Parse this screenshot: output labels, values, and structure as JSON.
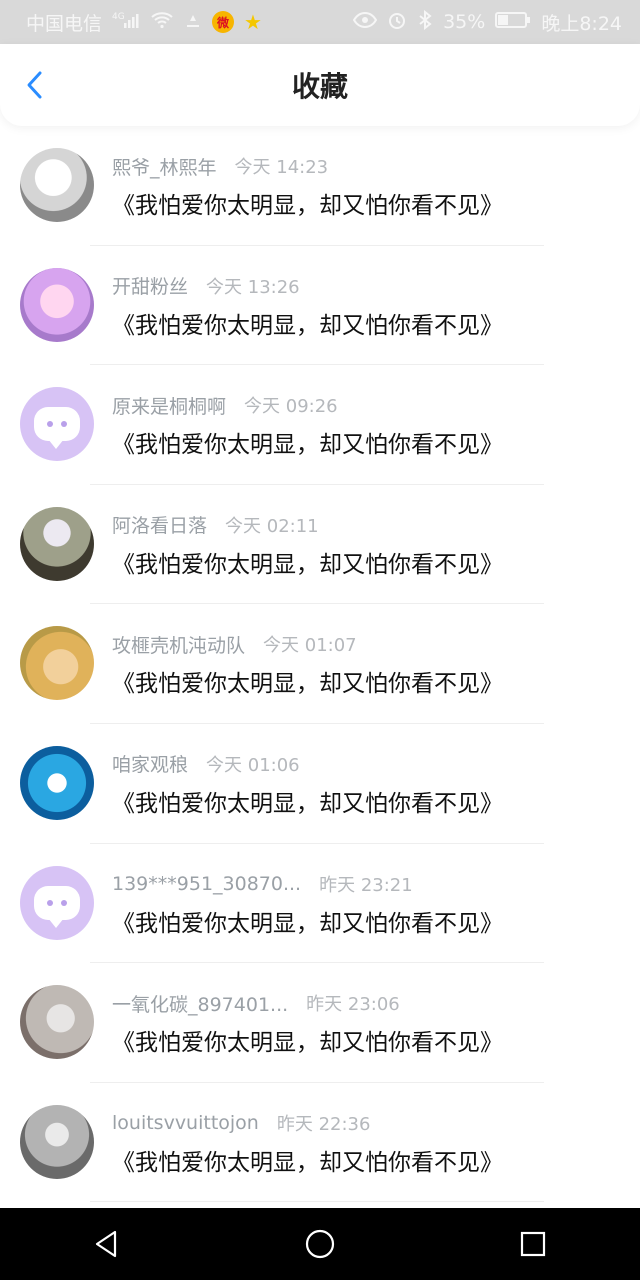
{
  "status_bar": {
    "carrier": "中国电信",
    "network": "4G",
    "battery": "35%",
    "time": "晚上8:24"
  },
  "header": {
    "title": "收藏"
  },
  "items": [
    {
      "name": "熙爷_林熙年",
      "time": "今天 14:23",
      "message": "《我怕爱你太明显，却又怕你看不见》"
    },
    {
      "name": "开甜粉丝",
      "time": "今天 13:26",
      "message": "《我怕爱你太明显，却又怕你看不见》"
    },
    {
      "name": "原来是桐桐啊",
      "time": "今天 09:26",
      "message": "《我怕爱你太明显，却又怕你看不见》"
    },
    {
      "name": "阿洛看日落",
      "time": "今天 02:11",
      "message": "《我怕爱你太明显，却又怕你看不见》"
    },
    {
      "name": "攻榧壳机沌动队",
      "time": "今天 01:07",
      "message": "《我怕爱你太明显，却又怕你看不见》"
    },
    {
      "name": "咱家观稂",
      "time": "今天 01:06",
      "message": "《我怕爱你太明显，却又怕你看不见》"
    },
    {
      "name": "139***951_30870...",
      "time": "昨天 23:21",
      "message": "《我怕爱你太明显，却又怕你看不见》"
    },
    {
      "name": "一氧化碳_897401...",
      "time": "昨天 23:06",
      "message": "《我怕爱你太明显，却又怕你看不见》"
    },
    {
      "name": "louitsvvuittojon",
      "time": "昨天 22:36",
      "message": "《我怕爱你太明显，却又怕你看不见》"
    }
  ],
  "colors": {
    "accent_blue": "#2a8cff",
    "default_avatar": "#d7c3f5"
  },
  "icons": {
    "back": "back-arrow-icon",
    "nav_back": "nav-back-icon",
    "nav_home": "nav-home-icon",
    "nav_recents": "nav-recents-icon"
  }
}
